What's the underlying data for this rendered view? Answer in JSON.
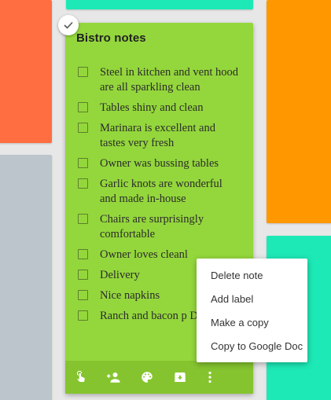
{
  "note": {
    "title": "Bistro notes",
    "color": "#94d73c",
    "items": [
      {
        "text": "Steel in kitchen and vent hood are all sparkling clean",
        "checked": false
      },
      {
        "text": "Tables shiny and clean",
        "checked": false
      },
      {
        "text": "Marinara is excellent and tastes very fresh",
        "checked": false
      },
      {
        "text": "Owner was bussing tables",
        "checked": false
      },
      {
        "text": "Garlic knots are wonderful and made in-house",
        "checked": false
      },
      {
        "text": "Chairs are surprisingly comfortable",
        "checked": false
      },
      {
        "text": "Owner loves cleanl",
        "checked": false
      },
      {
        "text": "Delivery",
        "checked": false
      },
      {
        "text": "Nice napkins",
        "checked": false
      },
      {
        "text": "Ranch and bacon p Delicious!",
        "checked": false
      }
    ],
    "toolbar": [
      {
        "icon": "touch-reminder-icon"
      },
      {
        "icon": "add-collaborator-icon"
      },
      {
        "icon": "palette-icon"
      },
      {
        "icon": "archive-icon"
      },
      {
        "icon": "more-vert-icon"
      }
    ]
  },
  "context_menu": {
    "items": [
      {
        "label": "Delete note"
      },
      {
        "label": "Add label"
      },
      {
        "label": "Make a copy"
      },
      {
        "label": "Copy to Google Doc"
      }
    ]
  },
  "neighbor_colors": {
    "teal": "#1de9b6",
    "orange_red": "#ff6e40",
    "gray": "#bcc5cc",
    "orange": "#ff9800"
  }
}
